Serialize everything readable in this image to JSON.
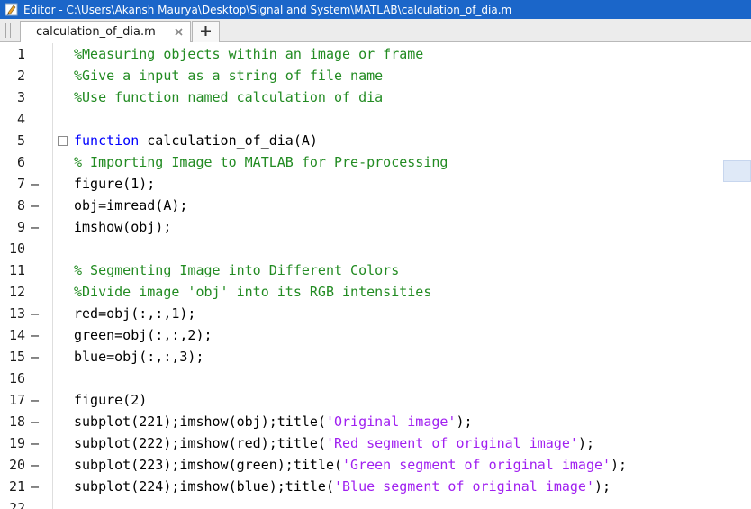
{
  "window": {
    "title": "Editor - C:\\Users\\Akansh Maurya\\Desktop\\Signal and System\\MATLAB\\calculation_of_dia.m",
    "icon": "editor-pencil-icon"
  },
  "tabs": [
    {
      "label": "calculation_of_dia.m",
      "active": true
    }
  ],
  "add_tab_icon": "plus-icon",
  "colors": {
    "keyword": "#0000ff",
    "comment": "#228b22",
    "string": "#a020f0",
    "titlebar": "#1b66c9"
  },
  "editor": {
    "lines": [
      {
        "num": "1",
        "bp": "",
        "segments": [
          {
            "t": "%Measuring objects within an image or frame",
            "c": "cm"
          }
        ]
      },
      {
        "num": "2",
        "bp": "",
        "segments": [
          {
            "t": "%Give a input as a string of file name",
            "c": "cm"
          }
        ]
      },
      {
        "num": "3",
        "bp": "",
        "segments": [
          {
            "t": "%Use function named calculation_of_dia",
            "c": "cm"
          }
        ]
      },
      {
        "num": "4",
        "bp": "",
        "segments": []
      },
      {
        "num": "5",
        "bp": "",
        "fold": true,
        "segments": [
          {
            "t": "function",
            "c": "kw"
          },
          {
            "t": " calculation_of_dia(A)",
            "c": ""
          }
        ]
      },
      {
        "num": "6",
        "bp": "",
        "segments": [
          {
            "t": "% Importing Image to MATLAB for Pre-processing",
            "c": "cm"
          }
        ]
      },
      {
        "num": "7",
        "bp": "—",
        "segments": [
          {
            "t": "figure(1);",
            "c": ""
          }
        ]
      },
      {
        "num": "8",
        "bp": "—",
        "segments": [
          {
            "t": "obj=imread(A);",
            "c": ""
          }
        ]
      },
      {
        "num": "9",
        "bp": "—",
        "segments": [
          {
            "t": "imshow(obj);",
            "c": ""
          }
        ]
      },
      {
        "num": "10",
        "bp": "",
        "segments": []
      },
      {
        "num": "11",
        "bp": "",
        "segments": [
          {
            "t": "% Segmenting Image into Different Colors",
            "c": "cm"
          }
        ]
      },
      {
        "num": "12",
        "bp": "",
        "segments": [
          {
            "t": "%Divide image 'obj' into its RGB intensities",
            "c": "cm"
          }
        ]
      },
      {
        "num": "13",
        "bp": "—",
        "segments": [
          {
            "t": "red=obj(:,:,1);",
            "c": ""
          }
        ]
      },
      {
        "num": "14",
        "bp": "—",
        "segments": [
          {
            "t": "green=obj(:,:,2);",
            "c": ""
          }
        ]
      },
      {
        "num": "15",
        "bp": "—",
        "segments": [
          {
            "t": "blue=obj(:,:,3);",
            "c": ""
          }
        ]
      },
      {
        "num": "16",
        "bp": "",
        "segments": []
      },
      {
        "num": "17",
        "bp": "—",
        "segments": [
          {
            "t": "figure(2)",
            "c": ""
          }
        ]
      },
      {
        "num": "18",
        "bp": "—",
        "segments": [
          {
            "t": "subplot(221);imshow(obj);title(",
            "c": ""
          },
          {
            "t": "'Original image'",
            "c": "str"
          },
          {
            "t": ");",
            "c": ""
          }
        ]
      },
      {
        "num": "19",
        "bp": "—",
        "segments": [
          {
            "t": "subplot(222);imshow(red);title(",
            "c": ""
          },
          {
            "t": "'Red segment of original image'",
            "c": "str"
          },
          {
            "t": ");",
            "c": ""
          }
        ]
      },
      {
        "num": "20",
        "bp": "—",
        "segments": [
          {
            "t": "subplot(223);imshow(green);title(",
            "c": ""
          },
          {
            "t": "'Green segment of original image'",
            "c": "str"
          },
          {
            "t": ");",
            "c": ""
          }
        ]
      },
      {
        "num": "21",
        "bp": "—",
        "segments": [
          {
            "t": "subplot(224);imshow(blue);title(",
            "c": ""
          },
          {
            "t": "'Blue segment of original image'",
            "c": "str"
          },
          {
            "t": ");",
            "c": ""
          }
        ]
      },
      {
        "num": "22",
        "bp": "",
        "segments": []
      }
    ]
  }
}
